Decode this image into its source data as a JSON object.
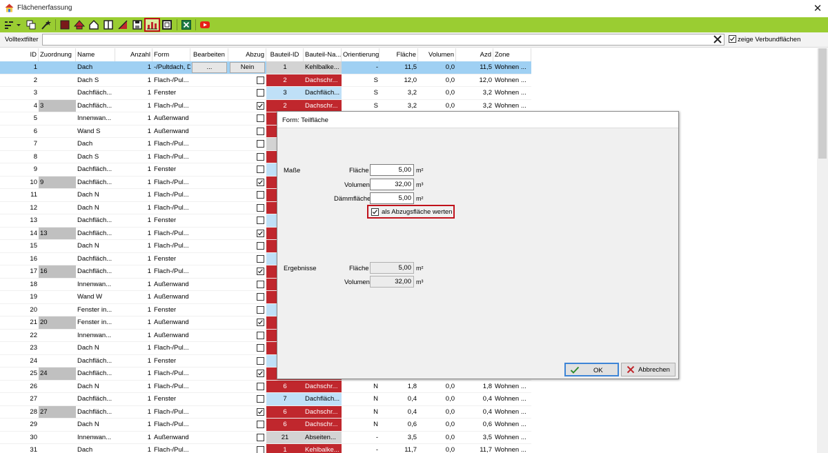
{
  "window": {
    "title": "Flächenerfassung",
    "close_glyph": "✕"
  },
  "filter": {
    "label": "Volltextfilter",
    "value": "",
    "show_verbund_label": "zeige Verbundflächen",
    "show_verbund_checked": true
  },
  "columns": [
    "ID",
    "Zuordnung",
    "Name",
    "Anzahl",
    "Form",
    "Bearbeiten",
    "Abzug",
    "Bauteil-ID",
    "Bauteil-Na...",
    "Orientierung",
    "Fläche",
    "Volumen",
    "Azd",
    "Zone"
  ],
  "rows": [
    {
      "id": "1",
      "zuordnung": "",
      "name": "Dach",
      "anzahl": "1",
      "form": "-/Pultdach, D",
      "bearbeiten": "...",
      "abzug": "Nein",
      "abzug_cb": null,
      "bid": "1",
      "bname": "Kehlbalke...",
      "orient": "-",
      "flaeche": "11,5",
      "volumen": "0,0",
      "azd": "11,5",
      "zone": "Wohnen ...",
      "bcolor": "gray",
      "selected": true
    },
    {
      "id": "2",
      "zuordnung": "",
      "name": "Dach S",
      "anzahl": "1",
      "form": "Flach-/Pul...",
      "abzug_cb": false,
      "bid": "2",
      "bname": "Dachschr...",
      "orient": "S",
      "flaeche": "12,0",
      "volumen": "0,0",
      "azd": "12,0",
      "zone": "Wohnen ...",
      "bcolor": "red"
    },
    {
      "id": "3",
      "zuordnung": "",
      "name": "Dachfläch...",
      "anzahl": "1",
      "form": "Fenster",
      "abzug_cb": false,
      "bid": "3",
      "bname": "Dachfläch...",
      "orient": "S",
      "flaeche": "3,2",
      "volumen": "0,0",
      "azd": "3,2",
      "zone": "Wohnen ...",
      "bcolor": "blue"
    },
    {
      "id": "4",
      "zuordnung": "3",
      "name": "Dachfläch...",
      "anzahl": "1",
      "form": "Flach-/Pul...",
      "abzug_cb": true,
      "bid": "2",
      "bname": "Dachschr...",
      "orient": "S",
      "flaeche": "3,2",
      "volumen": "0,0",
      "azd": "3,2",
      "zone": "Wohnen ...",
      "bcolor": "red"
    },
    {
      "id": "5",
      "zuordnung": "",
      "name": "Innenwan...",
      "anzahl": "1",
      "form": "Außenwand",
      "abzug_cb": false,
      "bcolor": "red"
    },
    {
      "id": "6",
      "zuordnung": "",
      "name": "Wand S",
      "anzahl": "1",
      "form": "Außenwand",
      "abzug_cb": false,
      "bcolor": "red"
    },
    {
      "id": "7",
      "zuordnung": "",
      "name": "Dach",
      "anzahl": "1",
      "form": "Flach-/Pul...",
      "abzug_cb": false,
      "bcolor": "gray"
    },
    {
      "id": "8",
      "zuordnung": "",
      "name": "Dach S",
      "anzahl": "1",
      "form": "Flach-/Pul...",
      "abzug_cb": false,
      "bcolor": "red"
    },
    {
      "id": "9",
      "zuordnung": "",
      "name": "Dachfläch...",
      "anzahl": "1",
      "form": "Fenster",
      "abzug_cb": false,
      "bcolor": "blue"
    },
    {
      "id": "10",
      "zuordnung": "9",
      "name": "Dachfläch...",
      "anzahl": "1",
      "form": "Flach-/Pul...",
      "abzug_cb": true,
      "bcolor": "red"
    },
    {
      "id": "11",
      "zuordnung": "",
      "name": "Dach N",
      "anzahl": "1",
      "form": "Flach-/Pul...",
      "abzug_cb": false,
      "bcolor": "red"
    },
    {
      "id": "12",
      "zuordnung": "",
      "name": "Dach N",
      "anzahl": "1",
      "form": "Flach-/Pul...",
      "abzug_cb": false,
      "bcolor": "red"
    },
    {
      "id": "13",
      "zuordnung": "",
      "name": "Dachfläch...",
      "anzahl": "1",
      "form": "Fenster",
      "abzug_cb": false,
      "bcolor": "blue"
    },
    {
      "id": "14",
      "zuordnung": "13",
      "name": "Dachfläch...",
      "anzahl": "1",
      "form": "Flach-/Pul...",
      "abzug_cb": true,
      "bcolor": "red"
    },
    {
      "id": "15",
      "zuordnung": "",
      "name": "Dach N",
      "anzahl": "1",
      "form": "Flach-/Pul...",
      "abzug_cb": false,
      "bcolor": "red"
    },
    {
      "id": "16",
      "zuordnung": "",
      "name": "Dachfläch...",
      "anzahl": "1",
      "form": "Fenster",
      "abzug_cb": false,
      "bcolor": "blue"
    },
    {
      "id": "17",
      "zuordnung": "16",
      "name": "Dachfläch...",
      "anzahl": "1",
      "form": "Flach-/Pul...",
      "abzug_cb": true,
      "bcolor": "red"
    },
    {
      "id": "18",
      "zuordnung": "",
      "name": "Innenwan...",
      "anzahl": "1",
      "form": "Außenwand",
      "abzug_cb": false,
      "bcolor": "red"
    },
    {
      "id": "19",
      "zuordnung": "",
      "name": "Wand W",
      "anzahl": "1",
      "form": "Außenwand",
      "abzug_cb": false,
      "bcolor": "red"
    },
    {
      "id": "20",
      "zuordnung": "",
      "name": "Fenster in...",
      "anzahl": "1",
      "form": "Fenster",
      "abzug_cb": false,
      "bcolor": "blue"
    },
    {
      "id": "21",
      "zuordnung": "20",
      "name": "Fenster in...",
      "anzahl": "1",
      "form": "Außenwand",
      "abzug_cb": true,
      "bcolor": "red"
    },
    {
      "id": "22",
      "zuordnung": "",
      "name": "Innenwan...",
      "anzahl": "1",
      "form": "Außenwand",
      "abzug_cb": false,
      "bcolor": "red"
    },
    {
      "id": "23",
      "zuordnung": "",
      "name": "Dach N",
      "anzahl": "1",
      "form": "Flach-/Pul...",
      "abzug_cb": false,
      "bcolor": "red"
    },
    {
      "id": "24",
      "zuordnung": "",
      "name": "Dachfläch...",
      "anzahl": "1",
      "form": "Fenster",
      "abzug_cb": false,
      "bcolor": "blue"
    },
    {
      "id": "25",
      "zuordnung": "24",
      "name": "Dachfläch...",
      "anzahl": "1",
      "form": "Flach-/Pul...",
      "abzug_cb": true,
      "bcolor": "red"
    },
    {
      "id": "26",
      "zuordnung": "",
      "name": "Dach N",
      "anzahl": "1",
      "form": "Flach-/Pul...",
      "abzug_cb": false,
      "bid": "6",
      "bname": "Dachschr...",
      "orient": "N",
      "flaeche": "1,8",
      "volumen": "0,0",
      "azd": "1,8",
      "zone": "Wohnen ...",
      "bcolor": "red"
    },
    {
      "id": "27",
      "zuordnung": "",
      "name": "Dachfläch...",
      "anzahl": "1",
      "form": "Fenster",
      "abzug_cb": false,
      "bid": "7",
      "bname": "Dachfläch...",
      "orient": "N",
      "flaeche": "0,4",
      "volumen": "0,0",
      "azd": "0,4",
      "zone": "Wohnen ...",
      "bcolor": "blue"
    },
    {
      "id": "28",
      "zuordnung": "27",
      "name": "Dachfläch...",
      "anzahl": "1",
      "form": "Flach-/Pul...",
      "abzug_cb": true,
      "bid": "6",
      "bname": "Dachschr...",
      "orient": "N",
      "flaeche": "0,4",
      "volumen": "0,0",
      "azd": "0,4",
      "zone": "Wohnen ...",
      "bcolor": "red"
    },
    {
      "id": "29",
      "zuordnung": "",
      "name": "Dach N",
      "anzahl": "1",
      "form": "Flach-/Pul...",
      "abzug_cb": false,
      "bid": "6",
      "bname": "Dachschr...",
      "orient": "N",
      "flaeche": "0,6",
      "volumen": "0,0",
      "azd": "0,6",
      "zone": "Wohnen ...",
      "bcolor": "red"
    },
    {
      "id": "30",
      "zuordnung": "",
      "name": "Innenwan...",
      "anzahl": "1",
      "form": "Außenwand",
      "abzug_cb": false,
      "bid": "21",
      "bname": "Abseiten...",
      "orient": "-",
      "flaeche": "3,5",
      "volumen": "0,0",
      "azd": "3,5",
      "zone": "Wohnen ...",
      "bcolor": "gray"
    },
    {
      "id": "31",
      "zuordnung": "",
      "name": "Dach",
      "anzahl": "1",
      "form": "Flach-/Pul...",
      "abzug_cb": false,
      "bid": "1",
      "bname": "Kehlbalke...",
      "orient": "-",
      "flaeche": "11,7",
      "volumen": "0,0",
      "azd": "11,7",
      "zone": "Wohnen ...",
      "bcolor": "red"
    }
  ],
  "dialog": {
    "title": "Form: Teilfläche",
    "masse_label": "Maße",
    "flaeche_label": "Fläche",
    "flaeche_value": "5,00",
    "flaeche_unit": "m²",
    "volumen_label": "Volumen",
    "volumen_value": "32,00",
    "volumen_unit": "m³",
    "daemm_label": "Dämmfläche",
    "daemm_value": "5,00",
    "daemm_unit": "m²",
    "abzug_label": "als Abzugsfläche werten",
    "abzug_checked": true,
    "ergebnisse_label": "Ergebnisse",
    "erg_flaeche_label": "Fläche",
    "erg_flaeche_value": "5,00",
    "erg_flaeche_unit": "m²",
    "erg_volumen_label": "Volumen",
    "erg_volumen_value": "32,00",
    "erg_volumen_unit": "m³",
    "ok_label": "OK",
    "cancel_label": "Abbrechen"
  },
  "colors": {
    "toolbar": "#9acd32",
    "red_cell": "#c0272d",
    "blue_cell": "#bfe0f7",
    "selection": "#9fd0f3",
    "highlight_border": "#c0101a"
  },
  "icons": [
    "app-house-icon",
    "close-icon",
    "layout-icon",
    "copy-icon",
    "wand-icon",
    "stop-icon",
    "roof-icon",
    "house-outline-icon",
    "columns-icon",
    "slope-icon",
    "save-icon",
    "bar-chart-icon",
    "panel-icon",
    "excel-icon",
    "video-icon",
    "clear-filter-icon",
    "ok-check-icon",
    "cancel-x-icon"
  ]
}
